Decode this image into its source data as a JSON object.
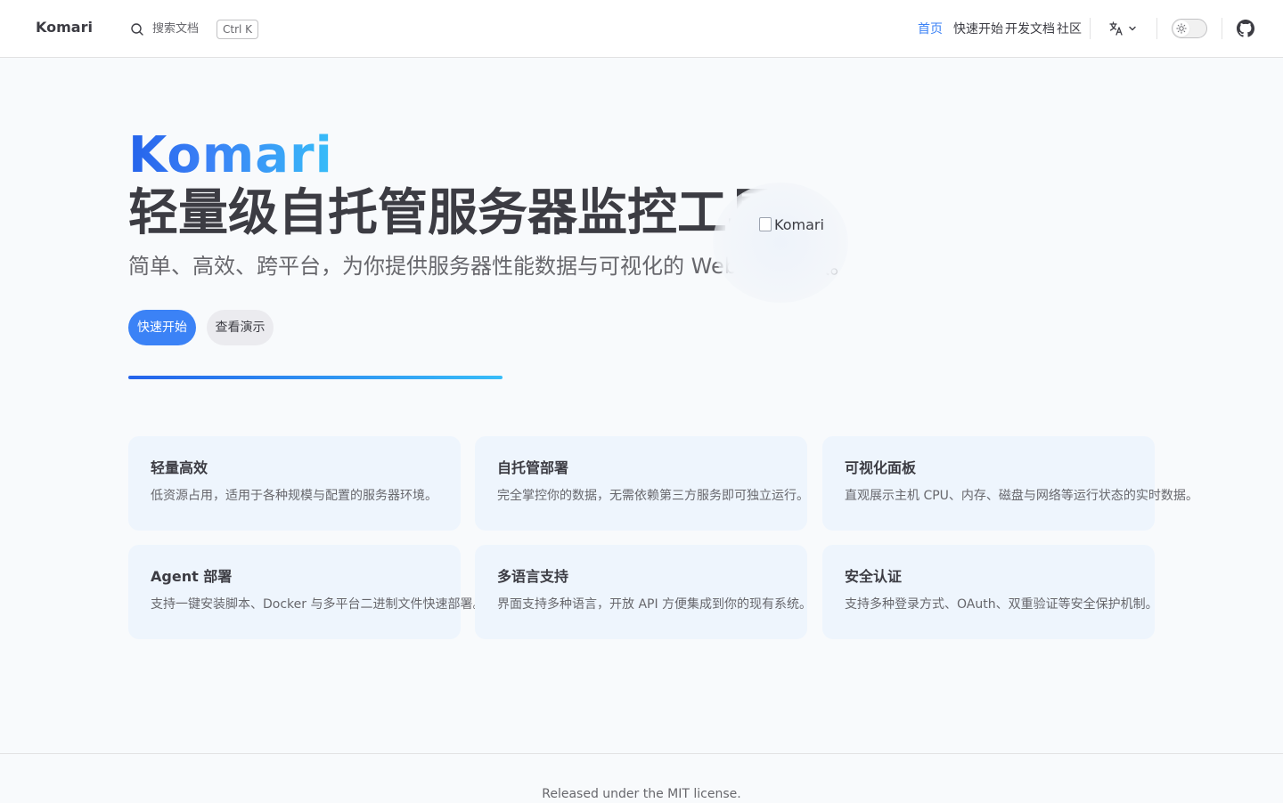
{
  "brand": "Komari",
  "search": {
    "label": "搜索文档",
    "shortcut": "Ctrl K"
  },
  "nav": {
    "items": [
      {
        "label": "首页",
        "active": true
      },
      {
        "label": "快速开始",
        "active": false
      },
      {
        "label": "开发文档",
        "active": false
      },
      {
        "label": "社区",
        "active": false
      }
    ],
    "language_icon": "translate-icon",
    "theme_icon": "sun-icon",
    "repo_icon": "github-icon"
  },
  "hero": {
    "name": "Komari",
    "text": "轻量级自托管服务器监控工具",
    "tagline": "简单、高效、跨平台，为你提供服务器性能数据与可视化的 Web 监控面板。",
    "primary_action": "快速开始",
    "secondary_action": "查看演示",
    "image_alt": "Komari"
  },
  "features": [
    {
      "title": "轻量高效",
      "details": "低资源占用，适用于各种规模与配置的服务器环境。"
    },
    {
      "title": "自托管部署",
      "details": "完全掌控你的数据，无需依赖第三方服务即可独立运行。"
    },
    {
      "title": "可视化面板",
      "details": "直观展示主机 CPU、内存、磁盘与网络等运行状态的实时数据。"
    },
    {
      "title": "Agent 部署",
      "details": "支持一键安装脚本、Docker 与多平台二进制文件快速部署。"
    },
    {
      "title": "多语言支持",
      "details": "界面支持多种语言，开放 API 方便集成到你的现有系统。"
    },
    {
      "title": "安全认证",
      "details": "支持多种登录方式、OAuth、双重验证等安全保护机制。"
    }
  ],
  "footer": {
    "message": "Released under the MIT license."
  },
  "colors": {
    "brand": "#3b82f6",
    "gradient_end": "#38bdf8",
    "card": "#eef5fd",
    "text": "#3c3c43",
    "muted": "#67676c"
  }
}
